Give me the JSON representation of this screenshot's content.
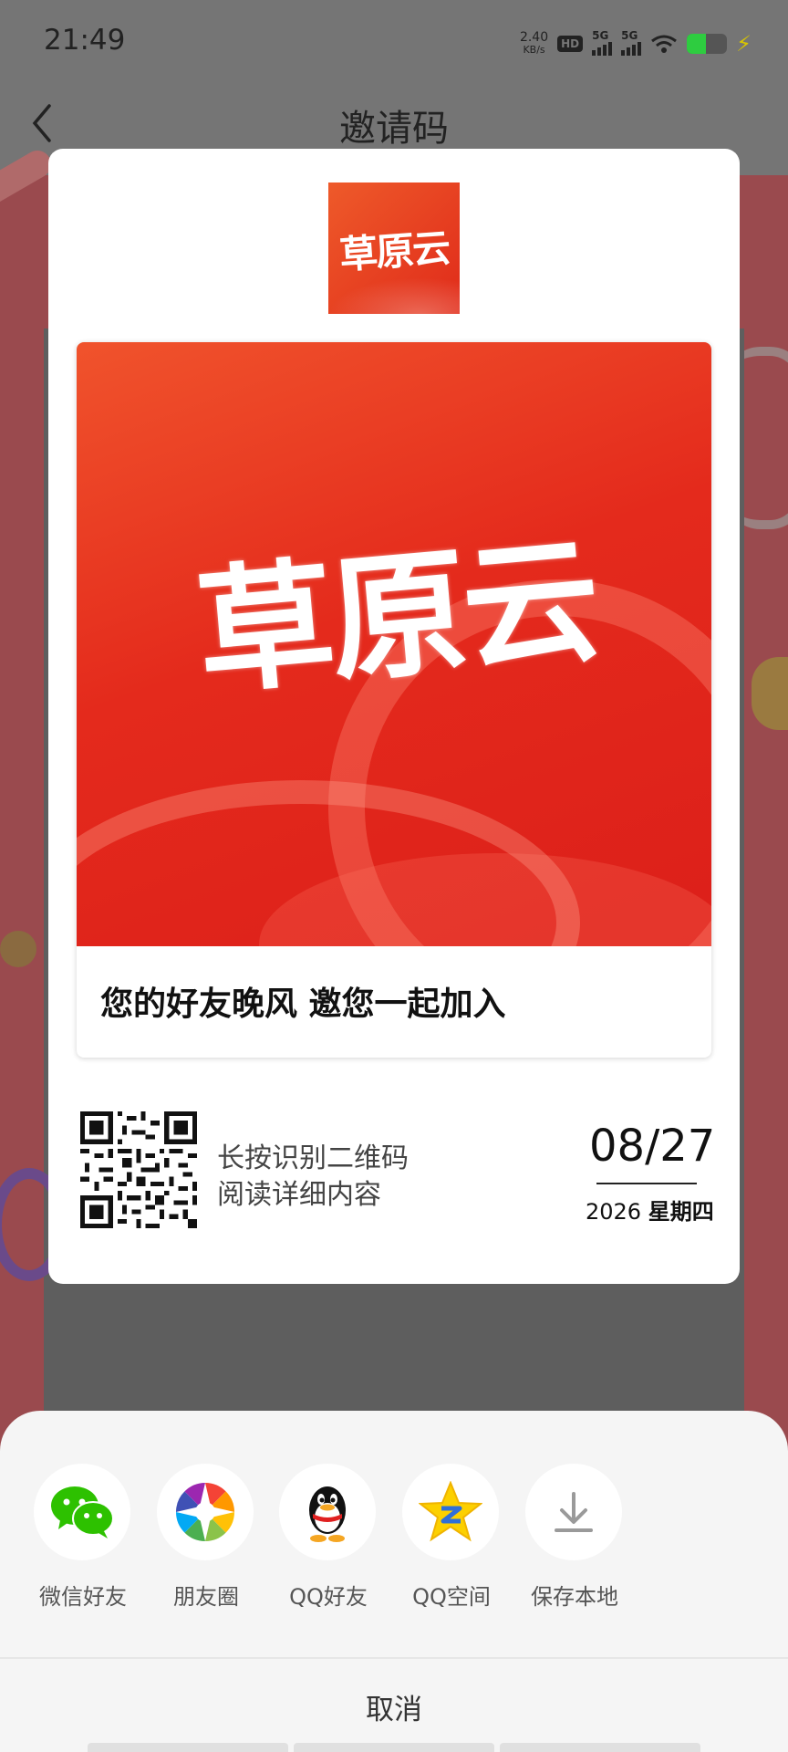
{
  "status_bar": {
    "time": "21:49",
    "net_speed_value": "2.40",
    "net_speed_unit": "KB/s",
    "hd_label": "HD",
    "sim1_label": "5G",
    "sim2_label": "5G",
    "battery_level_fraction": 0.48,
    "battery_color": "#2ecc40"
  },
  "header": {
    "title": "邀请码",
    "back_icon": "chevron-left-icon"
  },
  "card": {
    "logo_text": "草原云",
    "poster_text": "草原云",
    "invite_text": "您的好友晚风 邀您一起加入",
    "qr_hint_line1": "长按识别二维码",
    "qr_hint_line2": "阅读详细内容",
    "date_day": "08/27",
    "date_year": "2026",
    "date_weekday": "星期四",
    "accent_color": "#e42a1c"
  },
  "share_sheet": {
    "items": [
      {
        "label": "微信好友",
        "icon": "wechat-icon"
      },
      {
        "label": "朋友圈",
        "icon": "moments-icon"
      },
      {
        "label": "QQ好友",
        "icon": "qq-icon"
      },
      {
        "label": "QQ空间",
        "icon": "qzone-icon"
      },
      {
        "label": "保存本地",
        "icon": "download-icon"
      }
    ],
    "cancel_label": "取消"
  }
}
